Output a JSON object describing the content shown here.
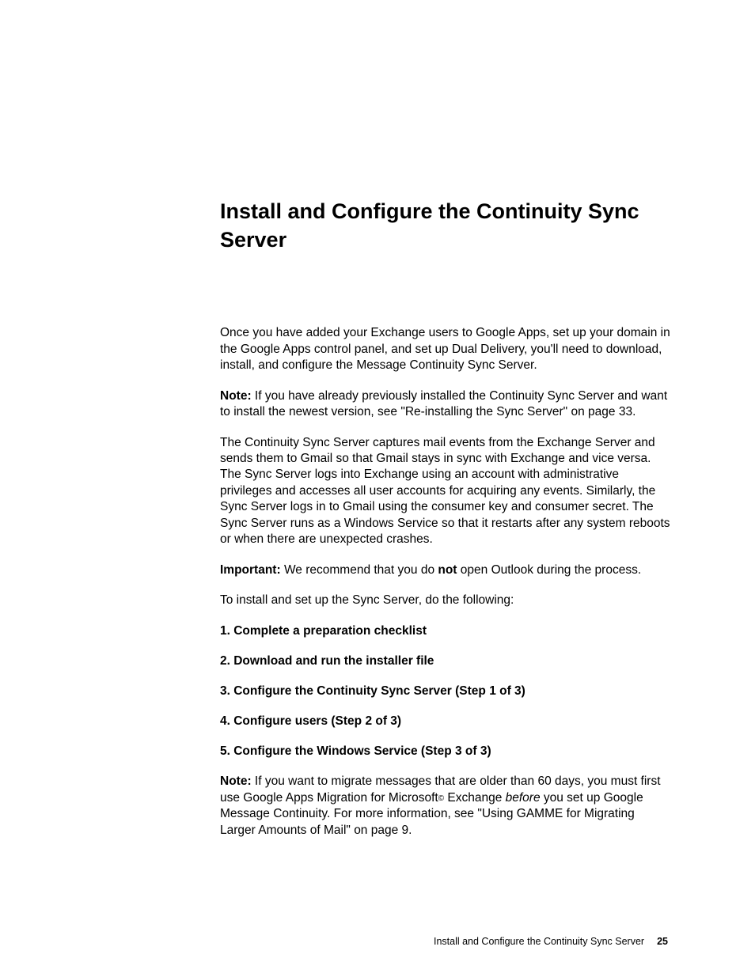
{
  "heading_pre": " ",
  "heading": "Install and Configure the Continuity Sync Server",
  "intro": "Once you have added your Exchange users to Google Apps, set up your domain in the Google Apps control panel, and set up Dual Delivery, you'll need to download, install, and configure the Message Continuity Sync Server.",
  "note1_label": "Note:",
  "note1_text": " If you have already previously installed the Continuity Sync Server and want to install the newest version, see \"Re-installing the Sync Server\" on page 33.",
  "desc": "The Continuity Sync Server captures mail events from the Exchange Server and sends them to Gmail so that Gmail stays in sync with Exchange and vice versa. The Sync Server logs into Exchange using an account with administrative privileges and accesses all user accounts for acquiring any events. Similarly, the Sync Server logs in to Gmail using the consumer key and consumer secret. The Sync Server runs as a Windows Service so that it restarts after any system reboots or when there are unexpected crashes.",
  "important_label": "Important:",
  "important_pre": " We recommend that you do ",
  "important_bold": "not",
  "important_post": " open Outlook during the process.",
  "lead": "To install and set up the Sync Server, do the following:",
  "steps": {
    "s1": "1. Complete a preparation checklist",
    "s2": "2. Download and run the installer file",
    "s3": "3. Configure the Continuity Sync Server (Step 1 of 3)",
    "s4": "4. Configure users (Step 2 of 3)",
    "s5": "5. Configure the Windows Service (Step 3 of 3)"
  },
  "note2_label": "Note:",
  "note2_pre": " If you want to migrate messages that are older than 60 days, you must first use Google Apps Migration for Microsoft",
  "note2_copy": "©",
  "note2_mid": " Exchange ",
  "note2_italic": "before",
  "note2_post": " you set up Google Message Continuity. For more information, see \"Using GAMME for Migrating Larger Amounts of Mail\" on page 9.",
  "footer_title": "Install and Configure the Continuity Sync Server",
  "footer_page": "25"
}
